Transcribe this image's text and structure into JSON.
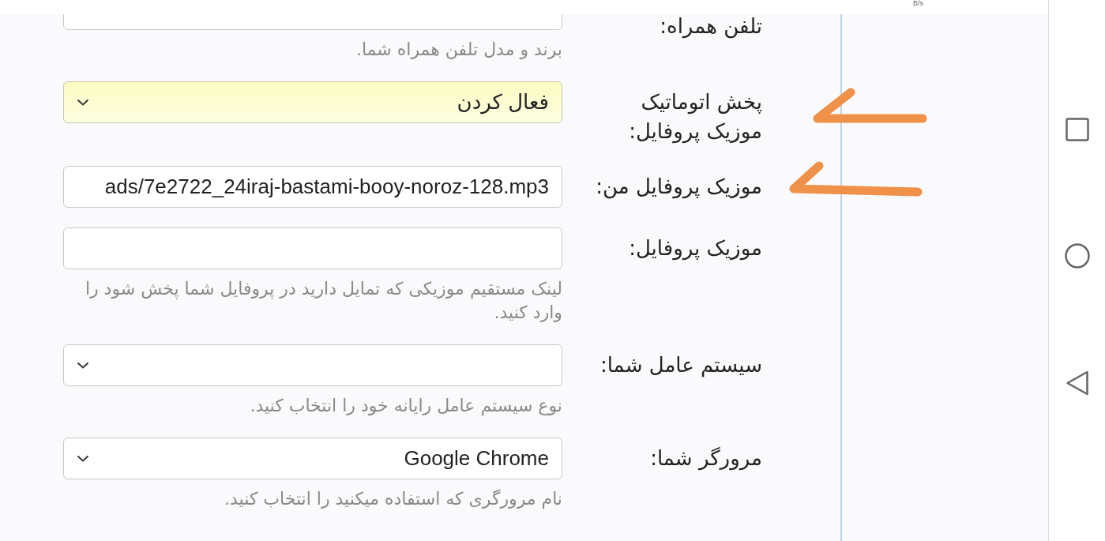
{
  "status_bar": {
    "network_speed": "B/s"
  },
  "form": {
    "fields": [
      {
        "kind": "text",
        "label": "تلفن همراه:",
        "hint": "برند و مدل تلفن همراه شما.",
        "highlighted": false
      },
      {
        "kind": "select",
        "label": "پخش اتوماتیک موزیک پروفایل:",
        "value": "فعال کردن",
        "highlighted": true
      },
      {
        "kind": "text",
        "label": "موزیک پروفایل من:",
        "value": "ads/7e2722_24iraj-bastami-booy-noroz-128.mp3",
        "highlighted": false
      },
      {
        "kind": "text",
        "label": "موزیک پروفایل:",
        "hint": "لینک مستقیم موزیکی که تمایل دارید در پروفایل شما پخش شود را وارد کنید.",
        "highlighted": false
      },
      {
        "kind": "select",
        "label": "سیستم عامل شما:",
        "hint": "نوع سیستم عامل رایانه خود را انتخاب کنید.",
        "highlighted": false
      },
      {
        "kind": "select",
        "label": "مرورگر شما:",
        "value": "Google Chrome",
        "hint": "نام مرورگری که استفاده میکنید را انتخاب کنید.",
        "highlighted": false
      }
    ]
  }
}
